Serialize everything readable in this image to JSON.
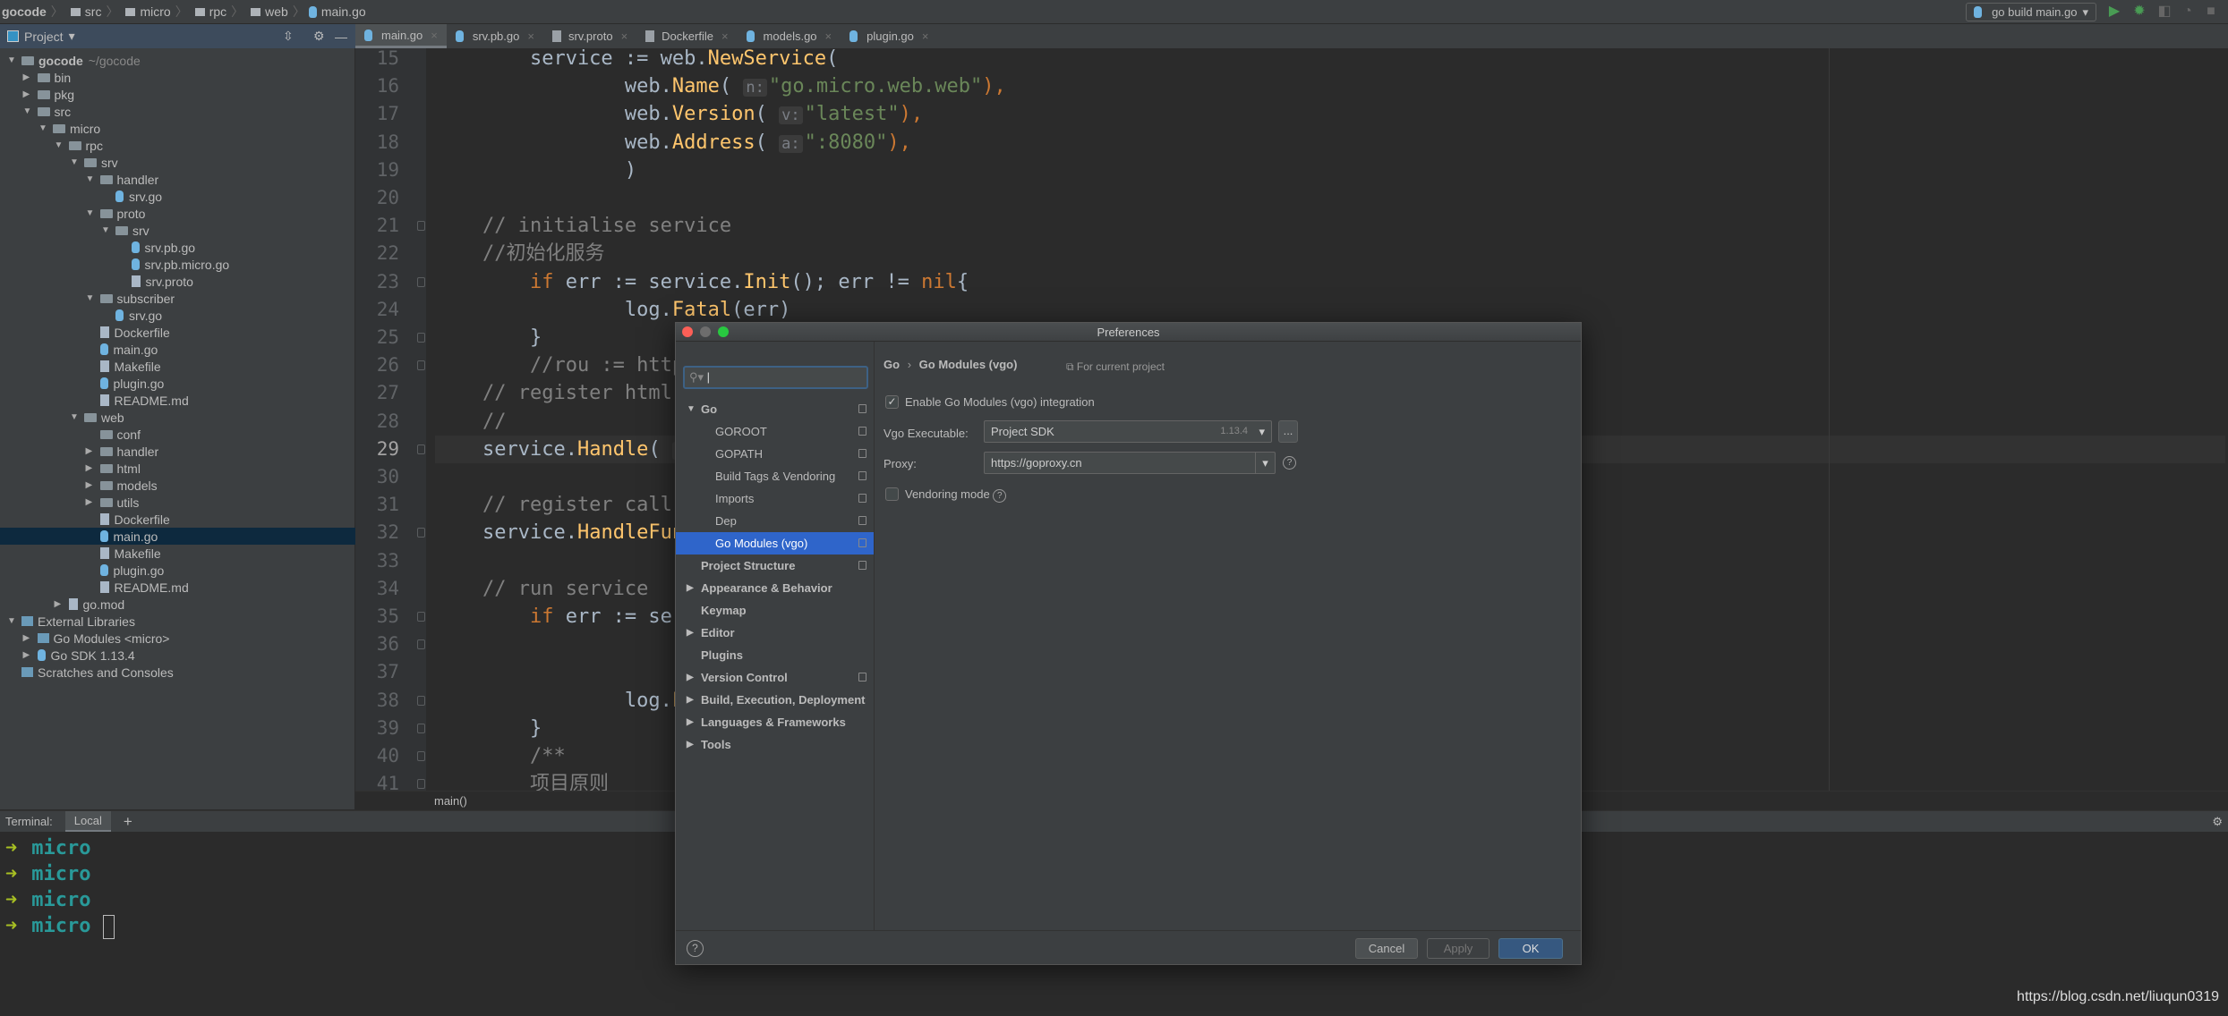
{
  "breadcrumb": [
    "gocode",
    "src",
    "micro",
    "rpc",
    "web",
    "main.go"
  ],
  "run_config": {
    "label": "go build main.go",
    "icons": [
      "run-icon",
      "debug-icon",
      "coverage-icon",
      "profile-icon",
      "stop-icon"
    ],
    "colors": {
      "run": "#499c54"
    }
  },
  "project_panel": {
    "title": "Project",
    "icons": [
      "collapse-all-icon",
      "gear-icon",
      "minimize-icon"
    ]
  },
  "tabs": [
    {
      "label": "main.go",
      "icon": "go",
      "active": true
    },
    {
      "label": "srv.pb.go",
      "icon": "go"
    },
    {
      "label": "srv.proto",
      "icon": "file"
    },
    {
      "label": "Dockerfile",
      "icon": "docker"
    },
    {
      "label": "models.go",
      "icon": "go"
    },
    {
      "label": "plugin.go",
      "icon": "go"
    }
  ],
  "tree": [
    {
      "d": 0,
      "t": "folder",
      "l": "gocode",
      "s": "~/gocode",
      "e": "open",
      "b": true
    },
    {
      "d": 1,
      "t": "folder",
      "l": "bin",
      "e": "closed"
    },
    {
      "d": 1,
      "t": "folder",
      "l": "pkg",
      "e": "closed"
    },
    {
      "d": 1,
      "t": "folder",
      "l": "src",
      "e": "open"
    },
    {
      "d": 2,
      "t": "folder",
      "l": "micro",
      "e": "open"
    },
    {
      "d": 3,
      "t": "folder",
      "l": "rpc",
      "e": "open"
    },
    {
      "d": 4,
      "t": "folder",
      "l": "srv",
      "e": "open"
    },
    {
      "d": 5,
      "t": "folder",
      "l": "handler",
      "e": "open"
    },
    {
      "d": 6,
      "t": "go",
      "l": "srv.go"
    },
    {
      "d": 5,
      "t": "folder",
      "l": "proto",
      "e": "open"
    },
    {
      "d": 6,
      "t": "folder",
      "l": "srv",
      "e": "open"
    },
    {
      "d": 7,
      "t": "go",
      "l": "srv.pb.go"
    },
    {
      "d": 7,
      "t": "go",
      "l": "srv.pb.micro.go"
    },
    {
      "d": 7,
      "t": "file",
      "l": "srv.proto"
    },
    {
      "d": 5,
      "t": "folder",
      "l": "subscriber",
      "e": "open"
    },
    {
      "d": 6,
      "t": "go",
      "l": "srv.go"
    },
    {
      "d": 5,
      "t": "file",
      "l": "Dockerfile"
    },
    {
      "d": 5,
      "t": "go",
      "l": "main.go"
    },
    {
      "d": 5,
      "t": "file",
      "l": "Makefile"
    },
    {
      "d": 5,
      "t": "go",
      "l": "plugin.go"
    },
    {
      "d": 5,
      "t": "file",
      "l": "README.md"
    },
    {
      "d": 4,
      "t": "folder",
      "l": "web",
      "e": "open"
    },
    {
      "d": 5,
      "t": "folder",
      "l": "conf"
    },
    {
      "d": 5,
      "t": "folder",
      "l": "handler",
      "e": "closed"
    },
    {
      "d": 5,
      "t": "folder",
      "l": "html",
      "e": "closed"
    },
    {
      "d": 5,
      "t": "folder",
      "l": "models",
      "e": "closed"
    },
    {
      "d": 5,
      "t": "folder",
      "l": "utils",
      "e": "closed"
    },
    {
      "d": 5,
      "t": "file",
      "l": "Dockerfile"
    },
    {
      "d": 5,
      "t": "go",
      "l": "main.go",
      "sel": true
    },
    {
      "d": 5,
      "t": "file",
      "l": "Makefile"
    },
    {
      "d": 5,
      "t": "go",
      "l": "plugin.go"
    },
    {
      "d": 5,
      "t": "file",
      "l": "README.md"
    },
    {
      "d": 3,
      "t": "file",
      "l": "go.mod",
      "e": "closed"
    },
    {
      "d": 0,
      "t": "lib",
      "l": "External Libraries",
      "e": "open"
    },
    {
      "d": 1,
      "t": "lib",
      "l": "Go Modules <micro>",
      "e": "closed"
    },
    {
      "d": 1,
      "t": "go",
      "l": "Go SDK 1.13.4",
      "e": "closed"
    },
    {
      "d": 0,
      "t": "lib",
      "l": "Scratches and Consoles"
    }
  ],
  "editor": {
    "current_line": 29,
    "lines": [
      {
        "n": 15,
        "tk": [
          [
            "id",
            "        service := "
          ],
          [
            "pkg",
            "web."
          ],
          [
            "fn",
            "NewService"
          ],
          [
            "id",
            "("
          ]
        ]
      },
      {
        "n": 16,
        "tk": [
          [
            "id",
            "                web."
          ],
          [
            "fn",
            "Name"
          ],
          [
            "id",
            "( "
          ],
          [
            "hint",
            "n:"
          ],
          [
            "str",
            "\"go.micro.web.web\""
          ],
          [
            "kw",
            "),"
          ]
        ]
      },
      {
        "n": 17,
        "tk": [
          [
            "id",
            "                web."
          ],
          [
            "fn",
            "Version"
          ],
          [
            "id",
            "( "
          ],
          [
            "hint",
            "v:"
          ],
          [
            "str",
            "\"latest\""
          ],
          [
            "kw",
            "),"
          ]
        ]
      },
      {
        "n": 18,
        "tk": [
          [
            "id",
            "                web."
          ],
          [
            "fn",
            "Address"
          ],
          [
            "id",
            "( "
          ],
          [
            "hint",
            "a:"
          ],
          [
            "str",
            "\":8080\""
          ],
          [
            "kw",
            "),"
          ]
        ]
      },
      {
        "n": 19,
        "tk": [
          [
            "id",
            "                )"
          ]
        ]
      },
      {
        "n": 20,
        "tk": []
      },
      {
        "n": 21,
        "tk": [
          [
            "cm",
            "    // initialise service"
          ]
        ]
      },
      {
        "n": 22,
        "tk": [
          [
            "cm",
            "    //初始化服务"
          ]
        ]
      },
      {
        "n": 23,
        "tk": [
          [
            "kw",
            "        if "
          ],
          [
            "id",
            "err := service."
          ],
          [
            "fn",
            "Init"
          ],
          [
            "id",
            "(); err != "
          ],
          [
            "kw",
            "nil"
          ],
          [
            "id",
            "{"
          ]
        ]
      },
      {
        "n": 24,
        "tk": [
          [
            "id",
            "                log."
          ],
          [
            "fn",
            "Fatal"
          ],
          [
            "id",
            "(err)"
          ]
        ]
      },
      {
        "n": 25,
        "tk": [
          [
            "id",
            "        }"
          ]
        ]
      },
      {
        "n": 26,
        "tk": [
          [
            "cm",
            "        //rou := http"
          ]
        ]
      },
      {
        "n": 27,
        "tk": [
          [
            "cm",
            "    // register html"
          ]
        ]
      },
      {
        "n": 28,
        "tk": [
          [
            "cm",
            "    //"
          ]
        ]
      },
      {
        "n": 29,
        "tk": [
          [
            "id",
            "    service."
          ],
          [
            "fn",
            "Handle"
          ],
          [
            "id",
            "( "
          ],
          [
            "hint",
            "pa"
          ]
        ]
      },
      {
        "n": 30,
        "tk": []
      },
      {
        "n": 31,
        "tk": [
          [
            "cm",
            "    // register call"
          ]
        ]
      },
      {
        "n": 32,
        "tk": [
          [
            "id",
            "    service."
          ],
          [
            "fn",
            "HandleFun"
          ]
        ]
      },
      {
        "n": 33,
        "tk": []
      },
      {
        "n": 34,
        "tk": [
          [
            "cm",
            "    // run service"
          ]
        ]
      },
      {
        "n": 35,
        "tk": [
          [
            "kw",
            "        if "
          ],
          [
            "id",
            "err := ser"
          ]
        ]
      },
      {
        "n": 36,
        "tk": []
      },
      {
        "n": 37,
        "tk": []
      },
      {
        "n": 38,
        "tk": [
          [
            "id",
            "                log."
          ],
          [
            "fn",
            "F"
          ]
        ]
      },
      {
        "n": 39,
        "tk": [
          [
            "id",
            "        }"
          ]
        ]
      },
      {
        "n": 40,
        "tk": [
          [
            "cm",
            "        /**"
          ]
        ]
      },
      {
        "n": 41,
        "tk": [
          [
            "cm",
            "        项目原则"
          ]
        ]
      }
    ],
    "folds": [
      21,
      23,
      25,
      26,
      29,
      32,
      35,
      36,
      38,
      39,
      40,
      41
    ],
    "status_function": "main()"
  },
  "terminal": {
    "label": "Terminal:",
    "tab": "Local",
    "add": "+",
    "prompt": "➜",
    "lines": [
      "micro",
      "micro",
      "micro",
      "micro"
    ]
  },
  "dialog": {
    "title": "Preferences",
    "search_placeholder": "",
    "nav": [
      {
        "l": "Go",
        "arrow": "open",
        "b": true,
        "copy": true,
        "ind": 0
      },
      {
        "l": "GOROOT",
        "copy": true,
        "ind": 1
      },
      {
        "l": "GOPATH",
        "copy": true,
        "ind": 1
      },
      {
        "l": "Build Tags & Vendoring",
        "copy": true,
        "ind": 1
      },
      {
        "l": "Imports",
        "copy": true,
        "ind": 1
      },
      {
        "l": "Dep",
        "copy": true,
        "ind": 1
      },
      {
        "l": "Go Modules (vgo)",
        "copy": true,
        "ind": 1,
        "sel": true
      },
      {
        "l": "Project Structure",
        "b": true,
        "copy": true,
        "ind": 0
      },
      {
        "l": "Appearance & Behavior",
        "arrow": "closed",
        "b": true,
        "ind": 0
      },
      {
        "l": "Keymap",
        "b": true,
        "ind": 0
      },
      {
        "l": "Editor",
        "arrow": "closed",
        "b": true,
        "ind": 0
      },
      {
        "l": "Plugins",
        "b": true,
        "ind": 0
      },
      {
        "l": "Version Control",
        "arrow": "closed",
        "b": true,
        "copy": true,
        "ind": 0
      },
      {
        "l": "Build, Execution, Deployment",
        "arrow": "closed",
        "b": true,
        "ind": 0
      },
      {
        "l": "Languages & Frameworks",
        "arrow": "closed",
        "b": true,
        "ind": 0
      },
      {
        "l": "Tools",
        "arrow": "closed",
        "b": true,
        "ind": 0
      }
    ],
    "crumb_parent": "Go",
    "crumb_sep": "›",
    "crumb_current": "Go Modules (vgo)",
    "scope": "For current project",
    "enable_label": "Enable Go Modules (vgo) integration",
    "enable_checked": true,
    "vgo_label": "Vgo Executable:",
    "vgo_value": "Project SDK",
    "vgo_version": "1.13.4",
    "browse": "...",
    "proxy_label": "Proxy:",
    "proxy_value": "https://goproxy.cn",
    "vendoring_label": "Vendoring mode",
    "vendoring_checked": false,
    "help": "?",
    "cancel": "Cancel",
    "apply": "Apply",
    "ok": "OK"
  },
  "watermark": "https://blog.csdn.net/liuqun0319"
}
